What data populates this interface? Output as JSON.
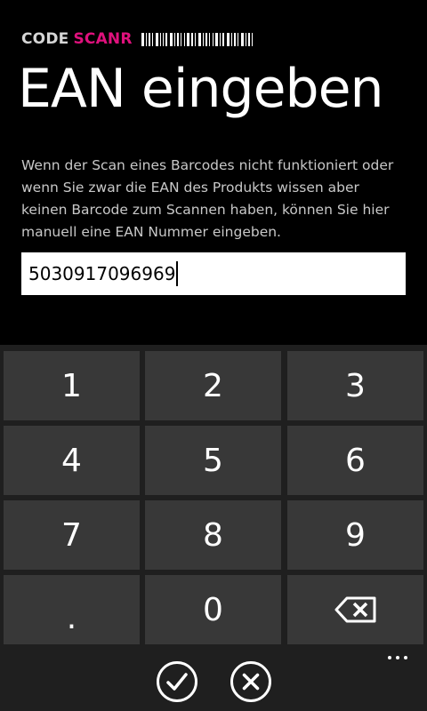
{
  "header": {
    "brand_code": "CODE",
    "brand_scanr": "SCANR",
    "accent_color": "#e0117d"
  },
  "page": {
    "title": "EAN eingeben",
    "description": "Wenn der Scan eines Barcodes nicht funktioniert oder wenn Sie zwar die EAN des Produkts wissen aber keinen Barcode zum Scannen haben, können Sie hier manuell eine EAN Nummer eingeben."
  },
  "ean_input": {
    "value": "5030917096969"
  },
  "keypad": {
    "keys": [
      "1",
      "2",
      "3",
      "4",
      "5",
      "6",
      "7",
      "8",
      "9",
      ".",
      "0"
    ],
    "backspace_icon": "backspace-icon"
  },
  "appbar": {
    "confirm_icon": "check-icon",
    "cancel_icon": "close-icon",
    "more_icon": "more-icon"
  }
}
